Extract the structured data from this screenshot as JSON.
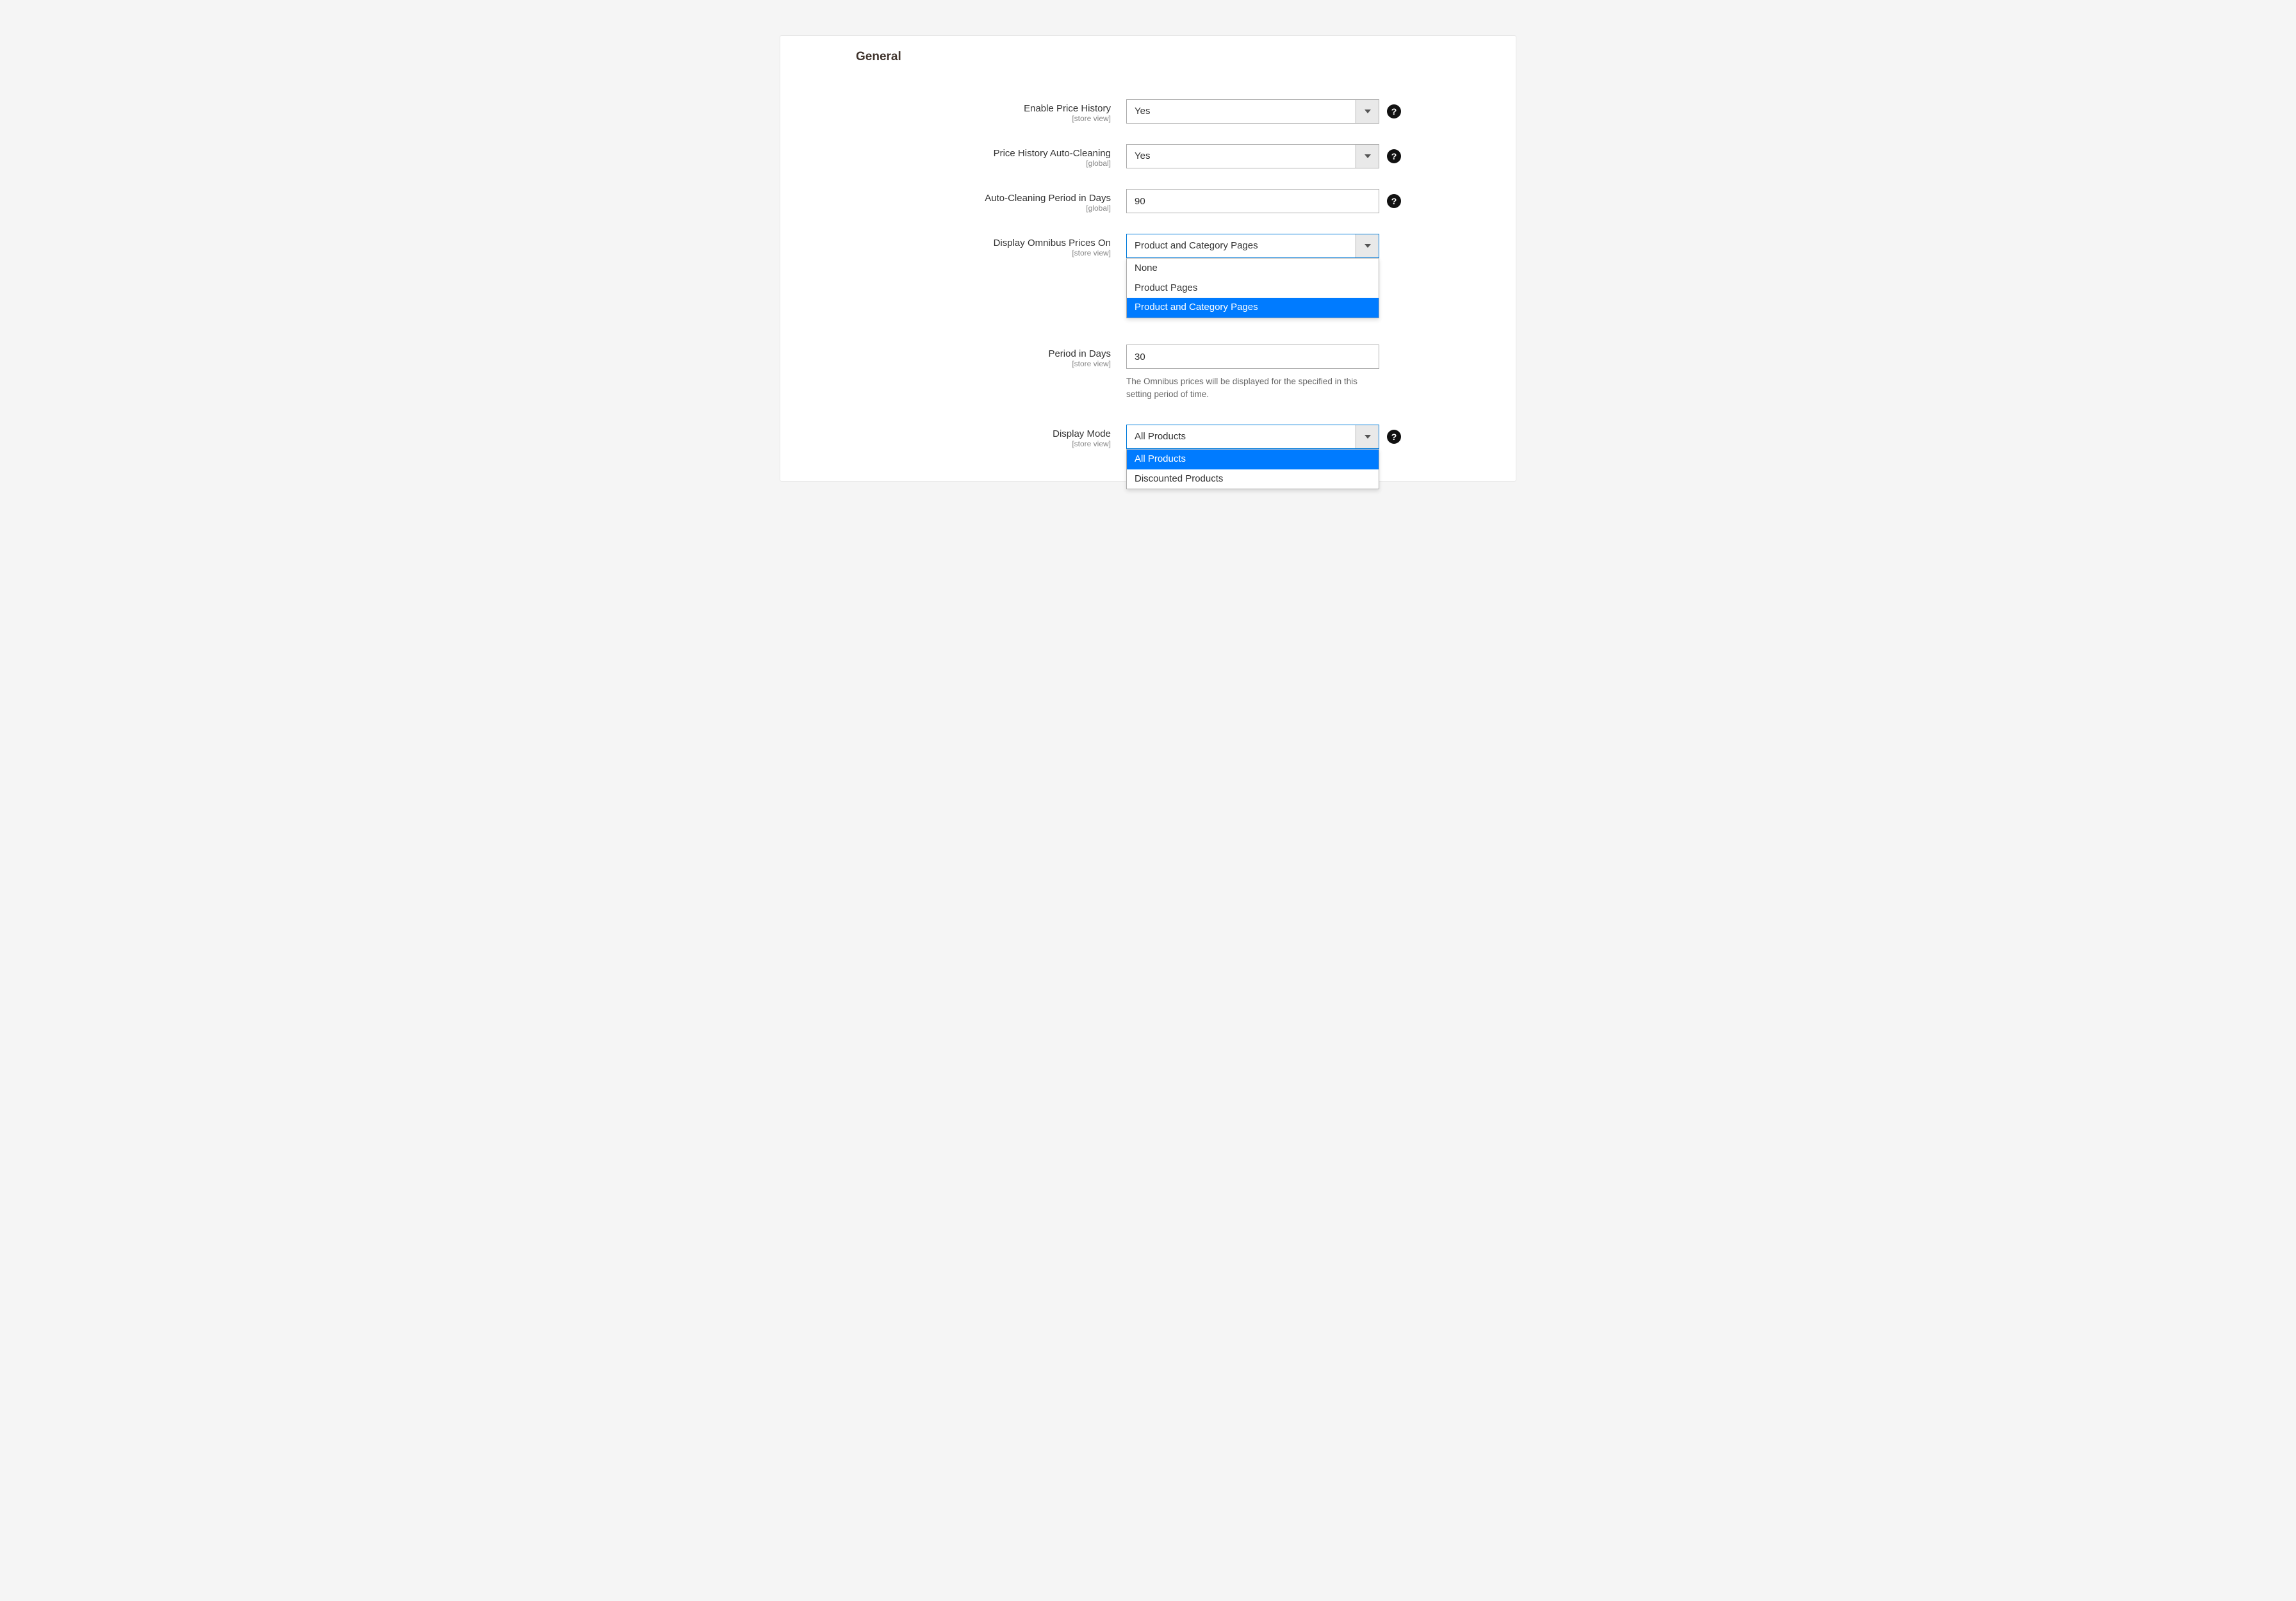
{
  "section_title": "General",
  "fields": {
    "enable_price_history": {
      "label": "Enable Price History",
      "scope": "[store view]",
      "value": "Yes"
    },
    "auto_cleaning": {
      "label": "Price History Auto-Cleaning",
      "scope": "[global]",
      "value": "Yes"
    },
    "auto_cleaning_period": {
      "label": "Auto-Cleaning Period in Days",
      "scope": "[global]",
      "value": "90"
    },
    "display_omnibus": {
      "label": "Display Omnibus Prices On",
      "scope": "[store view]",
      "value": "Product and Category Pages",
      "options": [
        "None",
        "Product Pages",
        "Product and Category Pages"
      ],
      "selected_index": 2
    },
    "period_in_days": {
      "label": "Period in Days",
      "scope": "[store view]",
      "value": "30",
      "hint": "The Omnibus prices will be displayed for the specified in this setting period of time."
    },
    "display_mode": {
      "label": "Display Mode",
      "scope": "[store view]",
      "value": "All Products",
      "options": [
        "All Products",
        "Discounted Products"
      ],
      "selected_index": 0
    }
  },
  "icons": {
    "help_glyph": "?"
  }
}
